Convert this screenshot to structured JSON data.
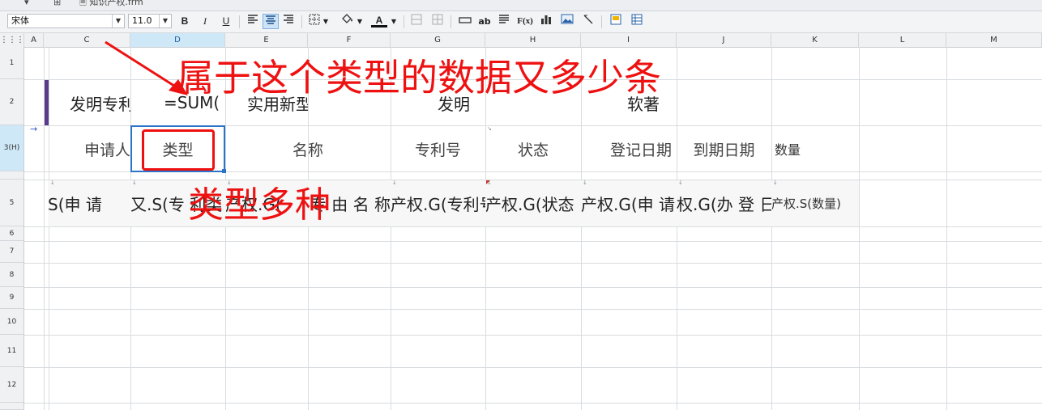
{
  "window": {
    "tab_title": "知识产权.frm"
  },
  "toolbar": {
    "font_name": "宋体",
    "font_size": "11.0",
    "bold_label": "B",
    "italic_label": "I",
    "underline_label": "U",
    "text_color_label": "A",
    "abc_label": "ab",
    "fx_label": "F(x)"
  },
  "columns": [
    "A",
    "C",
    "D",
    "E",
    "F",
    "G",
    "H",
    "I",
    "J",
    "K",
    "L",
    "M"
  ],
  "rows": [
    "1",
    "2",
    "3(H)",
    "5",
    "6",
    "7",
    "8",
    "9",
    "10",
    "11",
    "12"
  ],
  "row2": {
    "c": "发明专利",
    "d": "=SUM(",
    "e": "实用新型",
    "g": "发明",
    "i": "软著"
  },
  "row3": {
    "c": "申请人",
    "d": "类型",
    "e": "名称",
    "g": "专利号",
    "h": "状态",
    "i": "登记日期",
    "j": "到期日期",
    "k": "数量"
  },
  "row5": {
    "c": "S(申 请",
    "d": "又.S(专 利类",
    "e": "产权.G(",
    "f": "专 由 名 称",
    "g": "产权.G(专利号",
    "h": "产权.G(状态",
    "i": "产权.G(申 请",
    "j": "权.G(办 登 日",
    "k": "产权.S(数量)"
  },
  "annotations": {
    "top_text": "属于这个类型的数据又多少条",
    "middle_text": "类型多种",
    "color": "#ee1111"
  },
  "colors": {
    "selection": "#2b73c6",
    "header_selected": "#cfe8f8",
    "annotation": "#ee1111",
    "purple_marker": "#5b3a8c"
  }
}
